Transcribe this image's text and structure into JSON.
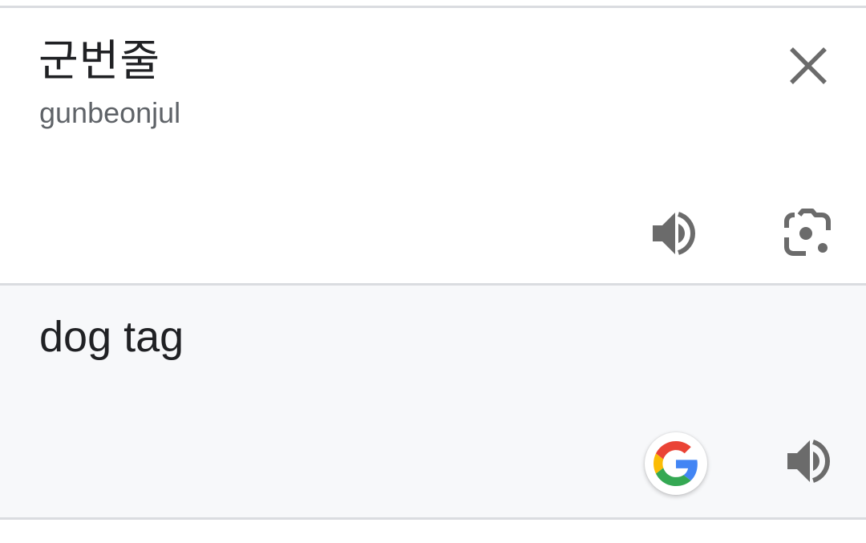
{
  "source": {
    "text": "군번줄",
    "transliteration": "gunbeonjul",
    "icons": {
      "close": "close-icon",
      "speak": "speaker-icon",
      "lens": "camera-lens-icon"
    }
  },
  "target": {
    "text": "dog tag",
    "icons": {
      "google": "google-g-icon",
      "speak": "speaker-icon"
    }
  },
  "colors": {
    "text_primary": "#202124",
    "text_secondary": "#5f6368",
    "icon_gray": "#6b6b6b",
    "divider": "#dadce0",
    "target_bg": "#f7f8fa",
    "google_blue": "#4285F4",
    "google_red": "#EA4335",
    "google_yellow": "#FBBC05",
    "google_green": "#34A853"
  }
}
